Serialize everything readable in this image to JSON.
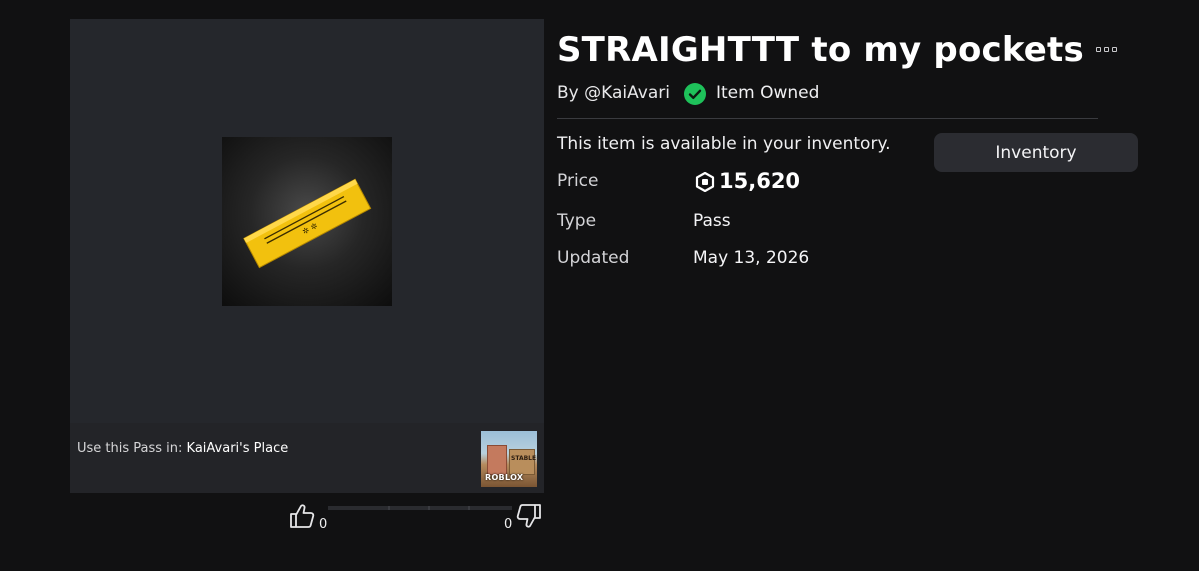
{
  "item": {
    "title": "STRAIGHTTT to my pockets",
    "by_prefix": "By ",
    "creator": "@KaiAvari",
    "owned_label": "Item Owned",
    "availability": "This item is available in your inventory.",
    "inventory_button": "Inventory",
    "details": {
      "price_label": "Price",
      "price_value": "15,620",
      "type_label": "Type",
      "type_value": "Pass",
      "updated_label": "Updated",
      "updated_value": "May 13, 2026"
    }
  },
  "game": {
    "prefix": "Use this Pass in: ",
    "name": "KaiAvari's Place",
    "thumb_sign": "STABLE",
    "thumb_logo": "ROBLOX"
  },
  "votes": {
    "up": "0",
    "down": "0"
  },
  "colors": {
    "background": "#111112",
    "panel": "#25272c",
    "owned_check": "#1ec15a",
    "pass_gold": "#f2c10e",
    "button_bg": "#2b2c31"
  },
  "icons": {
    "owned": "check-circle-icon",
    "currency": "robux-icon",
    "more": "more-options-icon",
    "vote_up": "thumb-up-icon",
    "vote_down": "thumb-down-icon"
  }
}
